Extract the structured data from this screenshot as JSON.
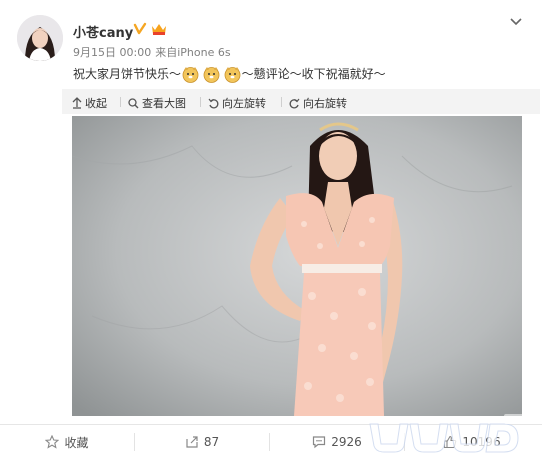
{
  "user": {
    "name": "小苍cany",
    "date": "9月15日 00:00",
    "source_prefix": "来自",
    "source": "iPhone 6s"
  },
  "post": {
    "text_before": "祝大家月饼节快乐～",
    "text_after": "～戆评论～收下祝福就好～",
    "emoji_names": [
      "doge-icon",
      "doge-icon",
      "doge-icon"
    ]
  },
  "toolbar": {
    "collapse": "收起",
    "view_large": "查看大图",
    "rotate_left": "向左旋转",
    "rotate_right": "向右旋转"
  },
  "actions": {
    "favorite": "收藏",
    "repost": "87",
    "comment": "2926",
    "like": "10196"
  },
  "colors": {
    "verified": "#f5a623",
    "toolbar_bg": "#f3f3f3",
    "meta_text": "#808080"
  }
}
